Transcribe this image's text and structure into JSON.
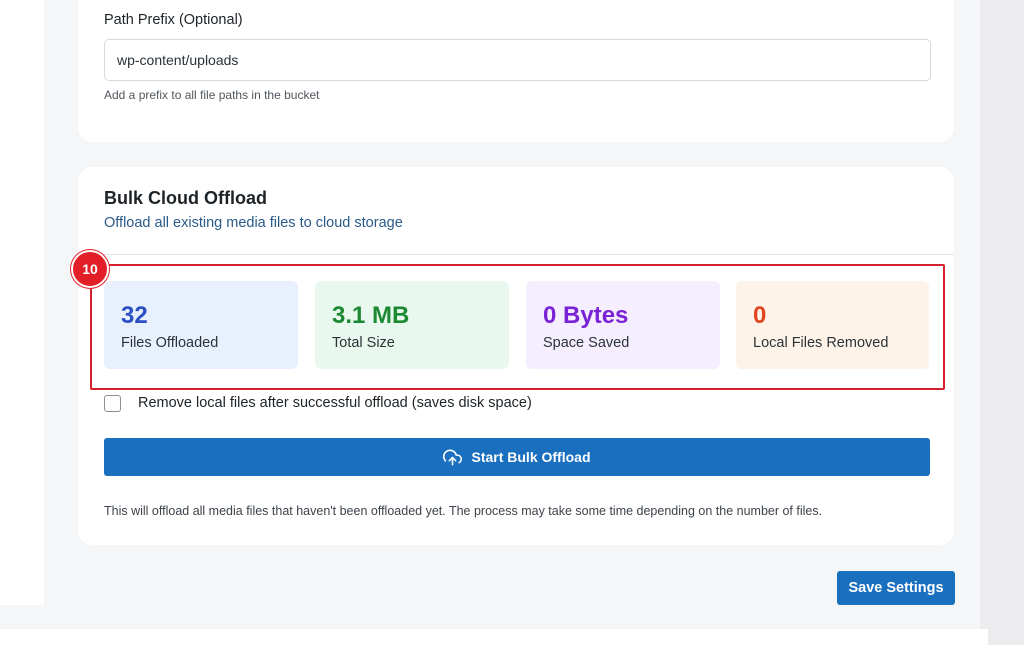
{
  "path_prefix": {
    "label": "Path Prefix (Optional)",
    "value": "wp-content/uploads",
    "help": "Add a prefix to all file paths in the bucket"
  },
  "bulk": {
    "title": "Bulk Cloud Offload",
    "subtitle": "Offload all existing media files to cloud storage",
    "step_badge": "10",
    "stats": [
      {
        "value": "32",
        "label": "Files Offloaded",
        "color": "#2b4fc0"
      },
      {
        "value": "3.1 MB",
        "label": "Total Size",
        "color": "#1c8a33"
      },
      {
        "value": "0 Bytes",
        "label": "Space Saved",
        "color": "#7a22d6"
      },
      {
        "value": "0",
        "label": "Local Files Removed",
        "color": "#e0451f"
      }
    ],
    "remove_local_label": "Remove local files after successful offload (saves disk space)",
    "remove_local_checked": false,
    "start_button": "Start Bulk Offload",
    "start_button_icon": "cloud-upload-icon",
    "note": "This will offload all media files that haven't been offloaded yet. The process may take some time depending on the number of files."
  },
  "save_button": "Save Settings",
  "colors": {
    "primary": "#1a6fbf",
    "highlight": "#d4202c"
  }
}
